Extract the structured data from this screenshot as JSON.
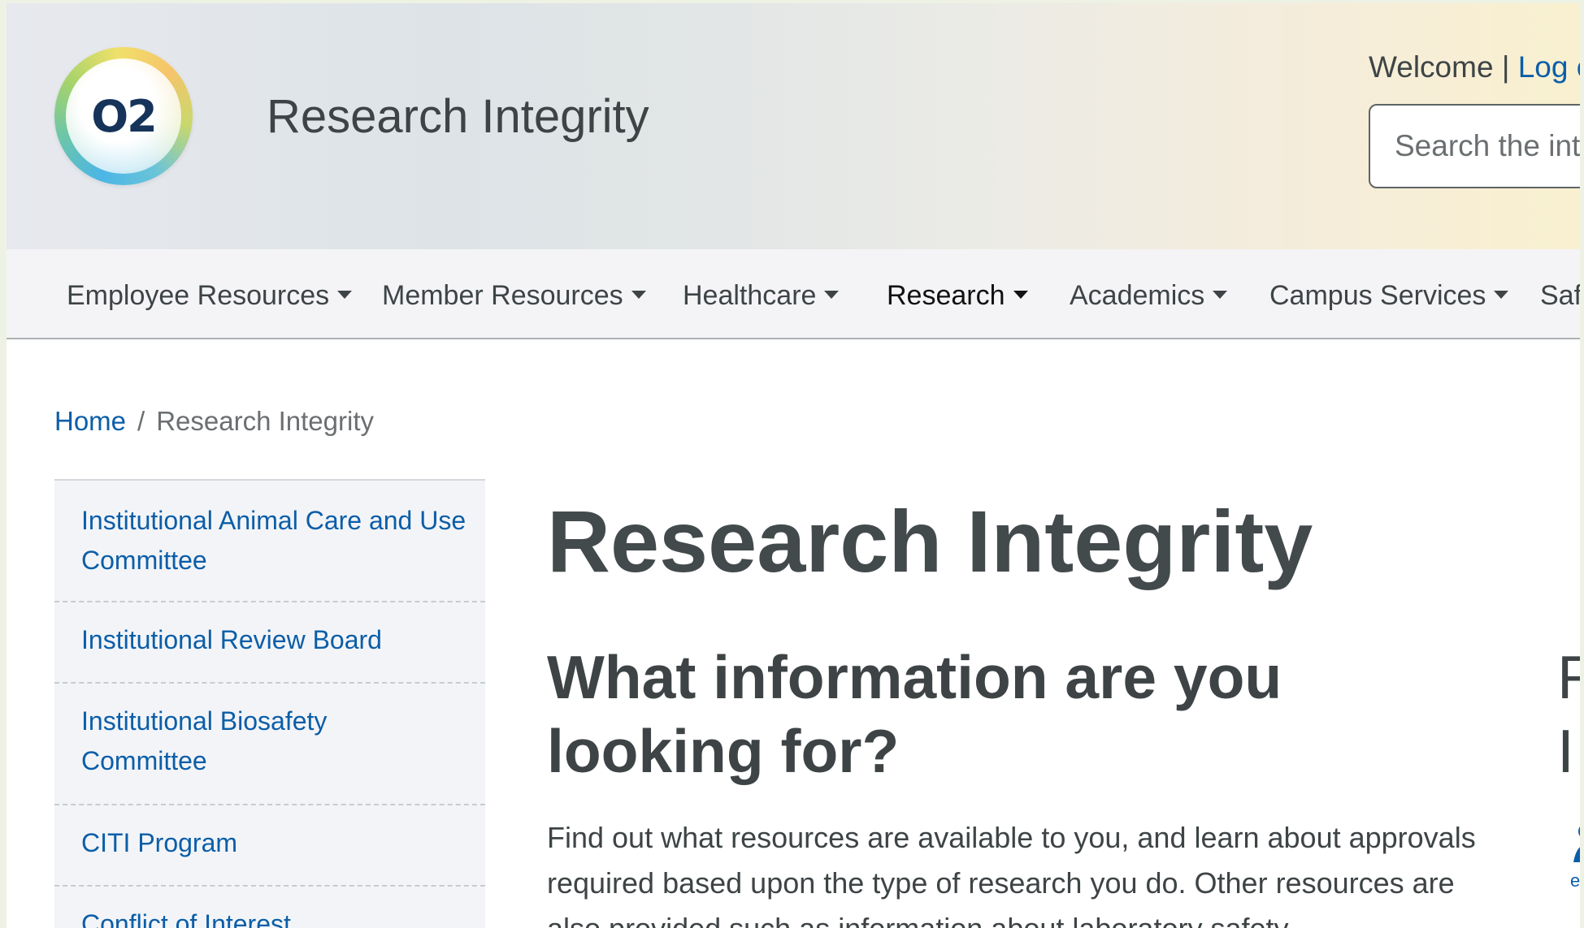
{
  "header": {
    "logo_text": "O2",
    "site_title": "Research Integrity",
    "welcome_text": "Welcome",
    "welcome_separator": "|",
    "logout_label": "Log o",
    "search_placeholder": "Search the intr"
  },
  "nav": {
    "items": [
      {
        "label": "Employee Resources"
      },
      {
        "label": "Member Resources"
      },
      {
        "label": "Healthcare"
      },
      {
        "label": "Research"
      },
      {
        "label": "Academics"
      },
      {
        "label": "Campus Services"
      },
      {
        "label": "Safe"
      }
    ]
  },
  "breadcrumb": {
    "home": "Home",
    "separator": "/",
    "current": "Research Integrity"
  },
  "sidebar": {
    "items": [
      {
        "label": "Institutional Animal Care and Use Committee"
      },
      {
        "label": "Institutional Review Board"
      },
      {
        "label": "Institutional Biosafety Committee"
      },
      {
        "label": "CITI Program"
      },
      {
        "label": "Conflict of Interest"
      }
    ]
  },
  "main": {
    "title": "Research Integrity",
    "subtitle": "What information are you looking for?",
    "body": "Find out what resources are available to you, and learn about approvals required based upon the type of research you do. Other resources are also provided such as information about laboratory safety.",
    "side_heading": "R I",
    "right_icon_text": "e"
  },
  "colors": {
    "link": "#0b5ea8",
    "text": "#3e4446",
    "nav_bg": "#f4f4f6"
  }
}
